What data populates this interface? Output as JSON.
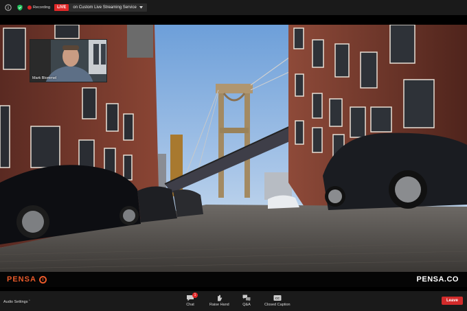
{
  "top_bar": {
    "recording_label": "Recording",
    "live_badge": "LIVE",
    "live_service": "on Custom Live Streaming Service"
  },
  "self_view": {
    "participant_name": "Mark Blommel"
  },
  "brand": {
    "left_logo": "PENSA",
    "right_logo": "PENSA.CO",
    "accent": "#ea5a2a"
  },
  "toolbar": {
    "audio_settings": "Audio Settings",
    "chat_label": "Chat",
    "chat_badge": "1",
    "raise_hand_label": "Raise Hand",
    "qa_label": "Q&A",
    "cc_label": "Closed Caption",
    "leave_label": "Leave"
  },
  "colors": {
    "live_red": "#e02828",
    "leave_red": "#d22b2b",
    "bar_bg": "#1a1a1a"
  }
}
